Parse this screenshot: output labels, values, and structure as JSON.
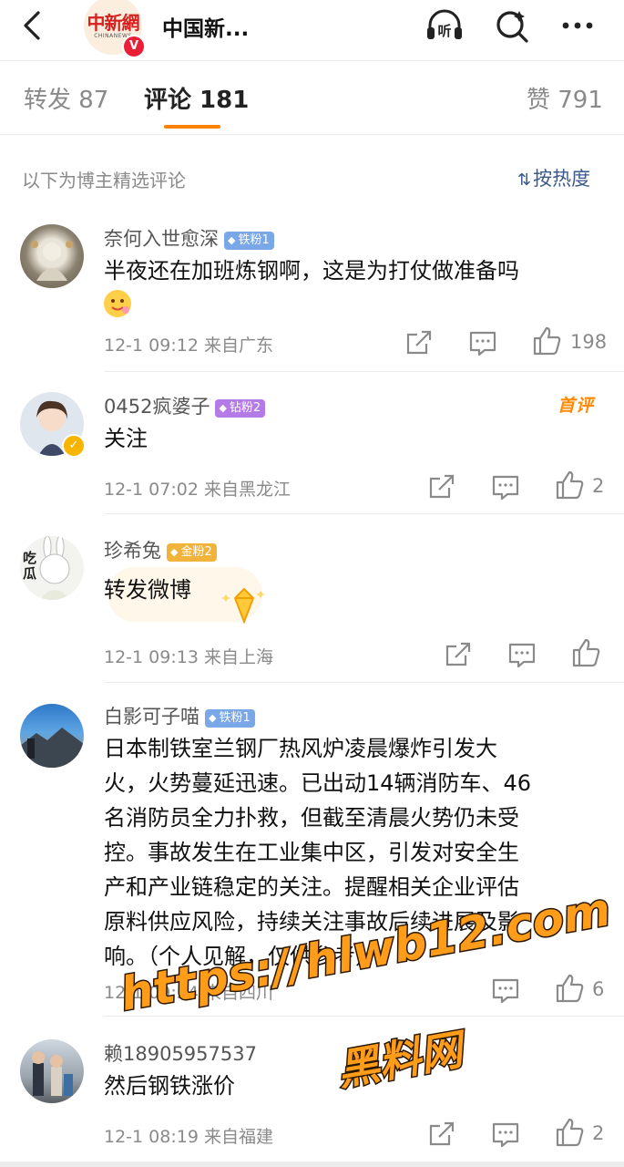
{
  "header": {
    "back_icon": "chevron-left-icon",
    "account_name": "中国新...",
    "logo_text": "中新網",
    "logo_subtext": "CHINANEWS",
    "verified_mark": "V",
    "listen_label": "听",
    "icons": [
      "listen-icon",
      "search-icon",
      "more-icon"
    ]
  },
  "tabs": [
    {
      "label": "转发 87"
    },
    {
      "label": "评论 181"
    },
    {
      "label": "赞 791"
    }
  ],
  "filter": {
    "caption": "以下为博主精选评论",
    "sort_label": "按热度"
  },
  "comments": [
    {
      "user": "奈何入世愈深",
      "badge": "铁粉1",
      "text": "半夜还在加班炼钢啊，这是为打仗做准备吗",
      "time_location": "12-1 09:12 来自广东",
      "likes": "198"
    },
    {
      "user": "0452疯婆子",
      "badge": "钻粉2",
      "tag": "首评",
      "text": "关注",
      "time_location": "12-1 07:02 来自黑龙江",
      "likes": "2"
    },
    {
      "user": "珍希兔",
      "badge": "金粉2",
      "avatar_text": "吃瓜",
      "text": "转发微博",
      "time_location": "12-1 09:13 来自上海",
      "likes": ""
    },
    {
      "user": "白影可子喵",
      "badge": "铁粉1",
      "text_lines": [
        "日本制铁室兰钢厂热风炉凌晨爆炸引发大",
        "火，火势蔓延迅速。已出动14辆消防车、46",
        "名消防员全力扑救，但截至清晨火势仍未受",
        "控。事故发生在工业集中区，引发对安全生",
        "产和产业链稳定的关注。提醒相关企业评估",
        "原料供应风险，持续关注事故后续进展及影",
        "响。（个人见解，仅供参考）"
      ],
      "time_location": "12-1 09:34 来自四川",
      "likes": "6"
    },
    {
      "user": "赖18905957537",
      "text": "然后钢铁涨价",
      "time_location": "12-1 08:19 来自福建",
      "likes": "2"
    }
  ],
  "watermark": {
    "url": "https://hlwb12.com",
    "name": "黑料网"
  },
  "colors": {
    "accent_orange": "#ff8200",
    "link_blue": "#3a5a8c",
    "iron_badge": "#7aa7e8",
    "diamond_badge": "#b47be8",
    "gold_badge": "#f2b33b",
    "verified_red": "#ea1f36"
  }
}
